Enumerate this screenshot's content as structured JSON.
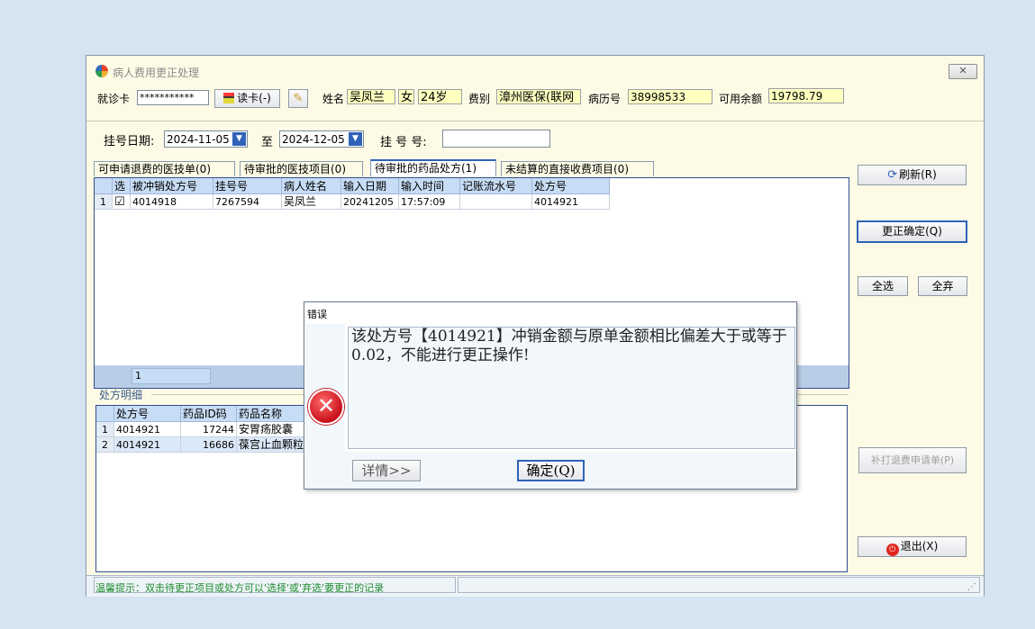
{
  "window": {
    "title": "病人费用更正处理",
    "close_label": "✕"
  },
  "patient": {
    "card_label": "就诊卡",
    "card_value": "***********",
    "read_card_label": "读卡(-)",
    "name_label": "姓名",
    "name_value": "吴凤兰",
    "gender_value": "女",
    "age_value": "24岁",
    "fee_type_label": "费别",
    "fee_type_value": "漳州医保(联网",
    "record_label": "病历号",
    "record_value": "38998533",
    "balance_label": "可用余额",
    "balance_value": "19798.79"
  },
  "filter": {
    "date_label": "挂号日期:",
    "date_from": "2024-11-05",
    "to_label": "至",
    "date_to": "2024-12-05",
    "reg_label": "挂 号 号:",
    "reg_value": ""
  },
  "tabs": [
    {
      "label": "可申请退费的医技单(0)"
    },
    {
      "label": "待审批的医技项目(0)"
    },
    {
      "label": "待审批的药品处方(1)"
    },
    {
      "label": "未结算的直接收费项目(0)"
    }
  ],
  "upper_grid": {
    "columns": [
      "选",
      "被冲销处方号",
      "挂号号",
      "病人姓名",
      "输入日期",
      "输入时间",
      "记账流水号",
      "处方号"
    ],
    "rows": [
      {
        "num": "1",
        "checked": "☑",
        "orig_rx": "4014918",
        "reg": "7267594",
        "name": "吴凤兰",
        "date": "20241205",
        "time": "17:57:09",
        "serial": "",
        "rx": "4014921"
      }
    ],
    "footer_count": "1"
  },
  "detail": {
    "section_label": "处方明细",
    "columns": [
      "处方号",
      "药品ID码",
      "药品名称"
    ],
    "rows": [
      {
        "num": "1",
        "rx": "4014921",
        "drug_id": "17244",
        "drug_name": "安胃疡胶囊"
      },
      {
        "num": "2",
        "rx": "4014921",
        "drug_id": "16686",
        "drug_name": "葆宫止血颗粒"
      }
    ]
  },
  "side_buttons": {
    "refresh": "刷新(R)",
    "confirm": "更正确定(Q)",
    "select_all": "全选",
    "discard_all": "全弃",
    "reprint": "补打退费申请单(P)",
    "exit": "退出(X)"
  },
  "status": {
    "hint": "温馨提示：双击待更正项目或处方可以'选择'或'弃选'要更正的记录"
  },
  "dialog": {
    "title": "错误",
    "message": "该处方号【4014921】冲销金额与原单金额相比偏差大于或等于0.02，不能进行更正操作!",
    "details_label": "详情>>",
    "ok_label": "确定(Q)"
  },
  "colors": {
    "window_bg": "#fdfbe6",
    "accent": "#2f62b8",
    "input_yellow": "#ffffc0",
    "status_green": "#1c8c2c"
  }
}
